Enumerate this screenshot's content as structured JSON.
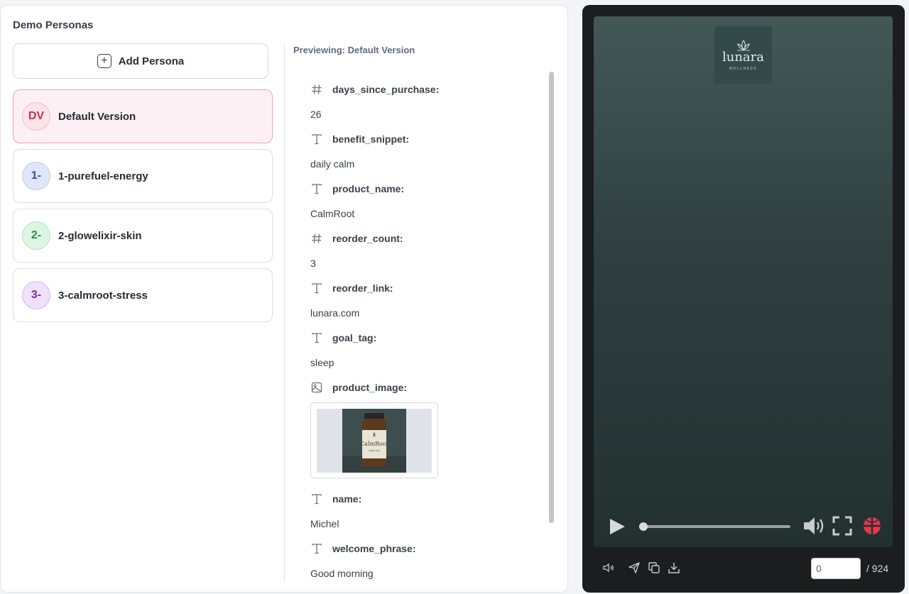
{
  "panel": {
    "title": "Demo Personas",
    "add_button_label": "Add Persona",
    "preview_label": "Previewing: Default Version"
  },
  "personas": [
    {
      "initials": "DV",
      "name": "Default Version",
      "active": true,
      "avatar_bg": "#fbe4ea",
      "avatar_fg": "#c0324f"
    },
    {
      "initials": "1-",
      "name": "1-purefuel-energy",
      "active": false,
      "avatar_bg": "#dfe6fb",
      "avatar_fg": "#3a4ea8"
    },
    {
      "initials": "2-",
      "name": "2-glowelixir-skin",
      "active": false,
      "avatar_bg": "#dcf6e2",
      "avatar_fg": "#2f8b4a"
    },
    {
      "initials": "3-",
      "name": "3-calmroot-stress",
      "active": false,
      "avatar_bg": "#f0e0f9",
      "avatar_fg": "#7a2f9a"
    }
  ],
  "fields": [
    {
      "icon": "hash-icon",
      "label": "days_since_purchase:",
      "value": "26"
    },
    {
      "icon": "text-icon",
      "label": "benefit_snippet:",
      "value": "daily calm"
    },
    {
      "icon": "text-icon",
      "label": "product_name:",
      "value": "CalmRoot"
    },
    {
      "icon": "hash-icon",
      "label": "reorder_count:",
      "value": "3"
    },
    {
      "icon": "text-icon",
      "label": "reorder_link:",
      "value": "lunara.com"
    },
    {
      "icon": "text-icon",
      "label": "goal_tag:",
      "value": "sleep"
    },
    {
      "icon": "image-icon",
      "label": "product_image:",
      "value": null
    },
    {
      "icon": "text-icon",
      "label": "name:",
      "value": "Michel"
    },
    {
      "icon": "text-icon",
      "label": "welcome_phrase:",
      "value": "Good morning"
    }
  ],
  "product_thumb": {
    "bottle_brand": "CalmRoot",
    "bottle_sub": "daily calm"
  },
  "video": {
    "brand_name": "lunara",
    "brand_sub": "WELLNESS",
    "progress": 0.0
  },
  "frame": {
    "current": "0",
    "total": "/ 924"
  },
  "colors": {
    "accent_pink": "#f0a2bb",
    "video_bg_top": "#445757",
    "video_bg_bottom": "#223030",
    "brand_red": "#e8364f"
  }
}
